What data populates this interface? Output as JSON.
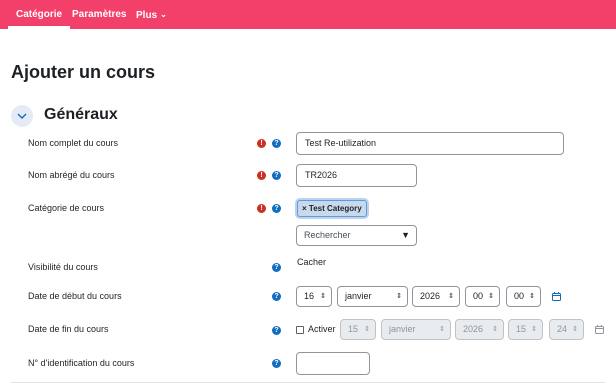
{
  "nav": {
    "items": [
      {
        "label": "Catégorie",
        "active": true
      },
      {
        "label": "Paramètres",
        "active": false
      },
      {
        "label": "Plus",
        "active": false
      }
    ]
  },
  "page": {
    "title": "Ajouter un cours"
  },
  "section": {
    "title": "Généraux"
  },
  "fields": {
    "fullname": {
      "label": "Nom complet du cours",
      "value": "Test Re-utilization"
    },
    "shortname": {
      "label": "Nom abrégé du cours",
      "value": "TR2026"
    },
    "category": {
      "label": "Catégorie de cours",
      "tag": "× Test Category",
      "search_placeholder": "Rechercher"
    },
    "visibility": {
      "label": "Visibilité du cours",
      "value": "Cacher"
    },
    "startdate": {
      "label": "Date de début du cours",
      "day": "16",
      "month": "janvier",
      "year": "2026",
      "hour": "00",
      "minute": "00"
    },
    "enddate": {
      "label": "Date de fin du cours",
      "enable_label": "Activer",
      "enabled": false,
      "day": "15",
      "month": "janvier",
      "year": "2026",
      "hour": "15",
      "minute": "24"
    },
    "idnumber": {
      "label": "N° d'identification du cours",
      "value": ""
    }
  },
  "icons": {
    "required": "exclamation-circle",
    "help": "question-circle",
    "calendar": "calendar",
    "collapse": "chevron-down"
  },
  "colors": {
    "nav_bg": "#f3406b",
    "required": "#ca3120",
    "help": "#0f6cbf",
    "link": "#0f6cbf"
  }
}
